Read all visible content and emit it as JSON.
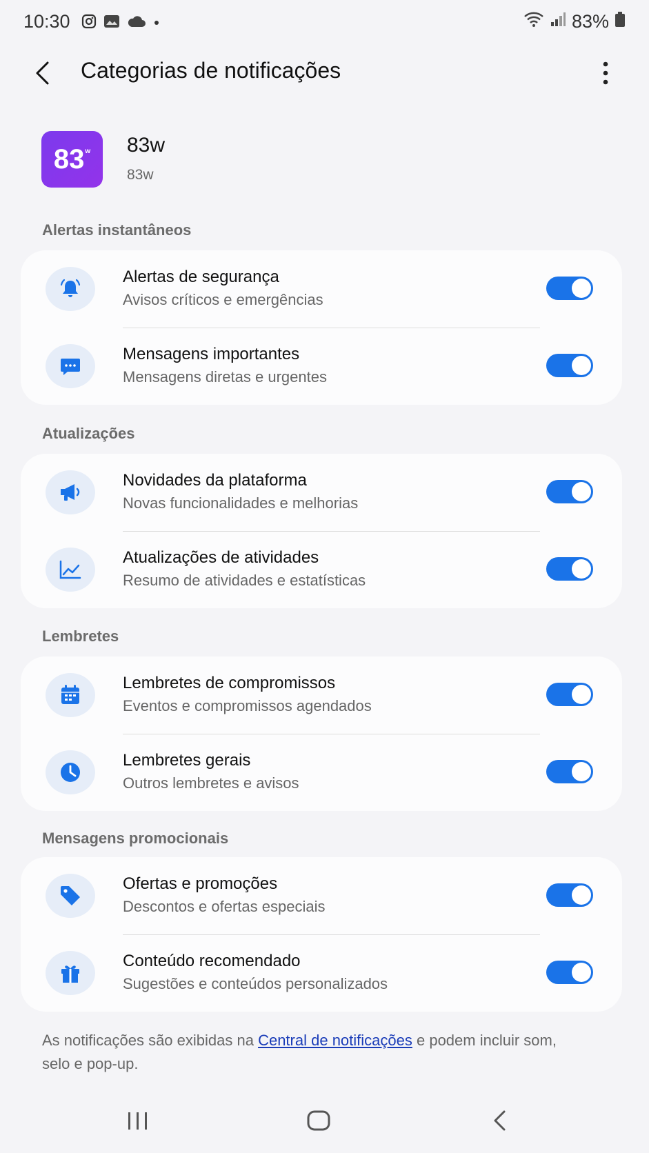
{
  "status_bar": {
    "time": "10:30",
    "battery": "83%",
    "icons": [
      "instagram-icon",
      "gallery-icon",
      "cloud-icon",
      "dot-icon",
      "wifi-icon",
      "signal-icon",
      "battery-icon"
    ]
  },
  "top_bar": {
    "title": "Categorias de notificações",
    "back_icon": "chevron-left-icon",
    "more_icon": "more-vert-icon"
  },
  "app": {
    "icon_text": "83",
    "icon_superscript": "w",
    "name": "83w",
    "subtitle": "83w",
    "icon_colors": [
      "#7c3aed",
      "#9333ea"
    ]
  },
  "sections": [
    {
      "label": "Alertas instantâneos",
      "items": [
        {
          "title": "Alertas de segurança",
          "subtitle": "Avisos críticos e emergências",
          "icon": "bell-alert-icon",
          "enabled": true
        },
        {
          "title": "Mensagens importantes",
          "subtitle": "Mensagens diretas e urgentes",
          "icon": "chat-bubble-icon",
          "enabled": true
        }
      ]
    },
    {
      "label": "Atualizações",
      "items": [
        {
          "title": "Novidades da plataforma",
          "subtitle": "Novas funcionalidades e melhorias",
          "icon": "megaphone-icon",
          "enabled": true
        },
        {
          "title": "Atualizações de atividades",
          "subtitle": "Resumo de atividades e estatísticas",
          "icon": "trend-chart-icon",
          "enabled": true
        }
      ]
    },
    {
      "label": "Lembretes",
      "items": [
        {
          "title": "Lembretes de compromissos",
          "subtitle": "Eventos e compromissos agendados",
          "icon": "calendar-icon",
          "enabled": true
        },
        {
          "title": "Lembretes gerais",
          "subtitle": "Outros lembretes e avisos",
          "icon": "clock-icon",
          "enabled": true
        }
      ]
    },
    {
      "label": "Mensagens promocionais",
      "items": [
        {
          "title": "Ofertas e promoções",
          "subtitle": "Descontos e ofertas especiais",
          "icon": "tag-icon",
          "enabled": true
        },
        {
          "title": "Conteúdo recomendado",
          "subtitle": "Sugestões e conteúdos personalizados",
          "icon": "gift-icon",
          "enabled": true
        }
      ]
    }
  ],
  "footer": {
    "text_before": "As notificações são exibidas na ",
    "link": "Central de notificações",
    "text_after": " e podem incluir som, selo e pop-up."
  },
  "nav_bar": {
    "recents_icon": "recents-icon",
    "home_icon": "home-icon",
    "back_icon": "back-icon"
  },
  "colors": {
    "accent": "#1a73e8",
    "icon_bg": "#e6edf8",
    "background": "#f4f4f7",
    "card": "#fcfcfd",
    "link": "#1a3cb8"
  }
}
